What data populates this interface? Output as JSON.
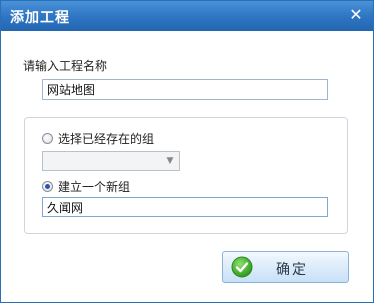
{
  "dialog": {
    "title": "添加工程",
    "close_glyph": "✕"
  },
  "project": {
    "label": "请输入工程名称",
    "name_value": "网站地图"
  },
  "group": {
    "existing_label": "选择已经存在的组",
    "existing_selected": false,
    "existing_value": "",
    "new_label": "建立一个新组",
    "new_selected": true,
    "new_value": "久闻网"
  },
  "buttons": {
    "confirm_label": "确定",
    "confirm_icon": "check-circle-icon"
  },
  "colors": {
    "titlebar": "#2d74c2",
    "confirm_check": "#3cad2a"
  }
}
